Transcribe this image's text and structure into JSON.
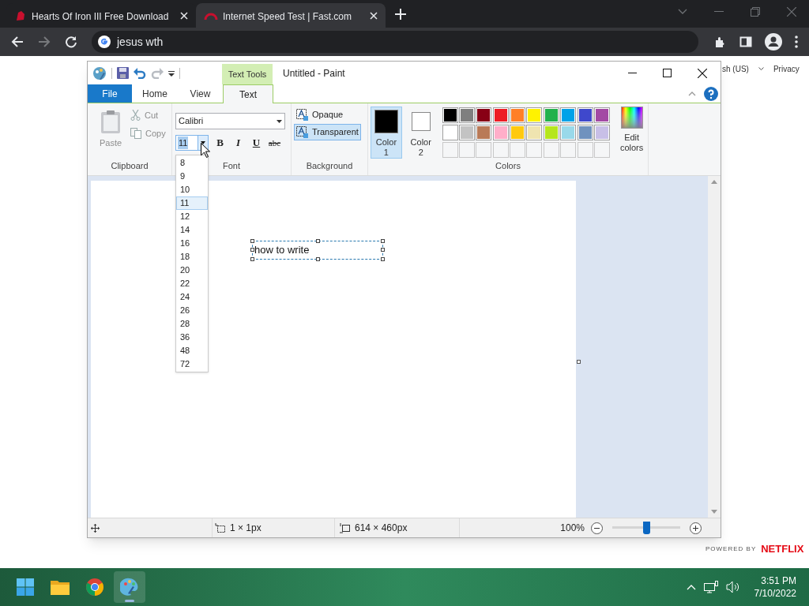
{
  "browser": {
    "tabs": [
      {
        "title": "Hearts Of Iron III Free Download",
        "selected": false,
        "kind": "game"
      },
      {
        "title": "Internet Speed Test | Fast.com",
        "selected": true,
        "kind": "speed"
      }
    ],
    "address": "jesus wth"
  },
  "web_page": {
    "language": "sh (US)",
    "privacy_link": "Privacy",
    "powered_by": "POWERED BY",
    "brand": "NETFLIX"
  },
  "paint": {
    "title": "Untitled - Paint",
    "contextual_tab": "Text Tools",
    "ribbon_tabs": [
      {
        "label": "File",
        "kind": "file",
        "selected": false
      },
      {
        "label": "Home",
        "kind": "tab",
        "selected": false
      },
      {
        "label": "View",
        "kind": "tab",
        "selected": false
      },
      {
        "label": "Text",
        "kind": "tab",
        "selected": true
      }
    ],
    "clipboard": {
      "paste": "Paste",
      "cut": "Cut",
      "copy": "Copy",
      "disabled": true,
      "label": "Clipboard"
    },
    "font": {
      "name": "Calibri",
      "size": "11",
      "styles": [
        "B",
        "I",
        "U",
        "abc"
      ],
      "label": "Font"
    },
    "background": {
      "options": [
        {
          "label": "Opaque",
          "selected": false
        },
        {
          "label": "Transparent",
          "selected": true
        }
      ],
      "label": "Background"
    },
    "colors": {
      "slots": [
        {
          "label": "Color",
          "number": "1",
          "color": "#000000",
          "selected": true
        },
        {
          "label": "Color",
          "number": "2",
          "color": "#ffffff",
          "selected": false
        }
      ],
      "palette": [
        {
          "color": "#000000"
        },
        {
          "color": "#7f7f7f"
        },
        {
          "color": "#880015"
        },
        {
          "color": "#ed1c24"
        },
        {
          "color": "#ff7f27"
        },
        {
          "color": "#fff200"
        },
        {
          "color": "#22b14c"
        },
        {
          "color": "#00a2e8"
        },
        {
          "color": "#3f48cc"
        },
        {
          "color": "#a349a4"
        },
        {
          "color": "#ffffff"
        },
        {
          "color": "#c3c3c3"
        },
        {
          "color": "#b97a57"
        },
        {
          "color": "#ffaec9"
        },
        {
          "color": "#ffc90e"
        },
        {
          "color": "#efe4b0"
        },
        {
          "color": "#b5e61d"
        },
        {
          "color": "#99d9ea"
        },
        {
          "color": "#7092be"
        },
        {
          "color": "#c8bfe7"
        }
      ],
      "edit": "Edit colors",
      "label": "Colors"
    },
    "canvas_text": "how to write",
    "size_options": [
      {
        "label": "8",
        "selected": false
      },
      {
        "label": "9",
        "selected": false
      },
      {
        "label": "10",
        "selected": false
      },
      {
        "label": "11",
        "selected": true
      },
      {
        "label": "12",
        "selected": false
      },
      {
        "label": "14",
        "selected": false
      },
      {
        "label": "16",
        "selected": false
      },
      {
        "label": "18",
        "selected": false
      },
      {
        "label": "20",
        "selected": false
      },
      {
        "label": "22",
        "selected": false
      },
      {
        "label": "24",
        "selected": false
      },
      {
        "label": "26",
        "selected": false
      },
      {
        "label": "28",
        "selected": false
      },
      {
        "label": "36",
        "selected": false
      },
      {
        "label": "48",
        "selected": false
      },
      {
        "label": "72",
        "selected": false
      }
    ],
    "status": {
      "selection": "1 × 1px",
      "canvas_size": "614 × 460px",
      "zoom": "100%",
      "level": 0.5
    }
  },
  "taskbar": {
    "apps": [
      {
        "kind": "start",
        "active": false
      },
      {
        "kind": "folder",
        "active": false
      },
      {
        "kind": "chrome",
        "active": false
      },
      {
        "kind": "paint",
        "active": true
      }
    ],
    "time": "3:51 PM",
    "date": "7/10/2022"
  }
}
